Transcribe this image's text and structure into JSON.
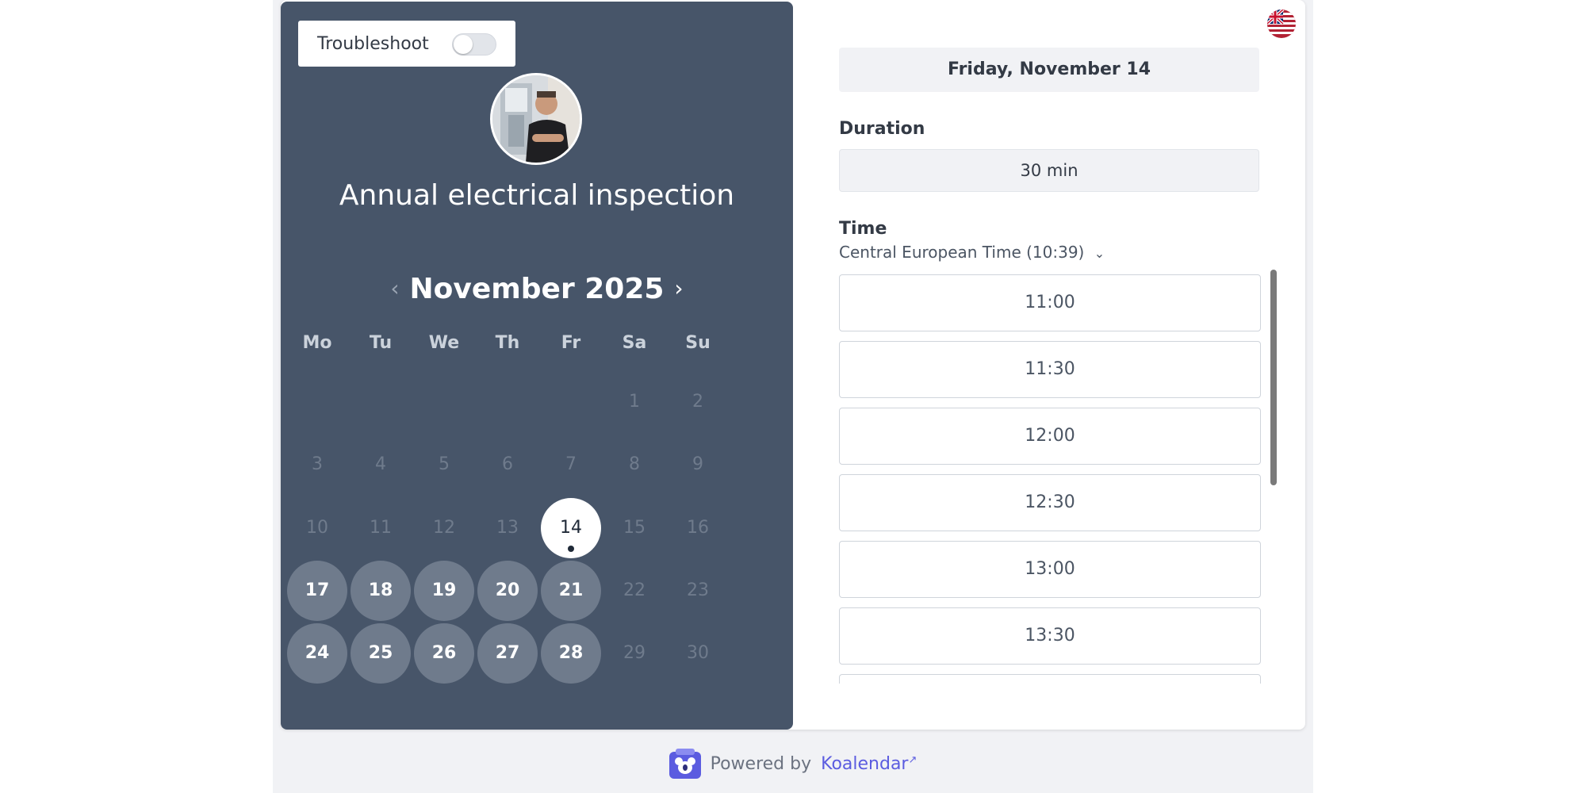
{
  "troubleshoot": {
    "label": "Troubleshoot",
    "enabled": false
  },
  "event": {
    "title": "Annual electrical inspection"
  },
  "calendar": {
    "month_label": "November 2025",
    "prev_icon": "chevron-left-icon",
    "next_icon": "chevron-right-icon",
    "weekdays": [
      "Mo",
      "Tu",
      "We",
      "Th",
      "Fr",
      "Sa",
      "Su"
    ],
    "days": [
      {
        "label": "1",
        "state": "disabled"
      },
      {
        "label": "2",
        "state": "disabled"
      },
      {
        "label": "3",
        "state": "disabled"
      },
      {
        "label": "4",
        "state": "disabled"
      },
      {
        "label": "5",
        "state": "disabled"
      },
      {
        "label": "6",
        "state": "disabled"
      },
      {
        "label": "7",
        "state": "disabled"
      },
      {
        "label": "8",
        "state": "disabled"
      },
      {
        "label": "9",
        "state": "disabled"
      },
      {
        "label": "10",
        "state": "disabled"
      },
      {
        "label": "11",
        "state": "disabled"
      },
      {
        "label": "12",
        "state": "disabled"
      },
      {
        "label": "13",
        "state": "disabled"
      },
      {
        "label": "14",
        "state": "selected"
      },
      {
        "label": "15",
        "state": "disabled"
      },
      {
        "label": "16",
        "state": "disabled"
      },
      {
        "label": "17",
        "state": "available"
      },
      {
        "label": "18",
        "state": "available"
      },
      {
        "label": "19",
        "state": "available"
      },
      {
        "label": "20",
        "state": "available"
      },
      {
        "label": "21",
        "state": "available"
      },
      {
        "label": "22",
        "state": "disabled"
      },
      {
        "label": "23",
        "state": "disabled"
      },
      {
        "label": "24",
        "state": "available"
      },
      {
        "label": "25",
        "state": "available"
      },
      {
        "label": "26",
        "state": "available"
      },
      {
        "label": "27",
        "state": "available"
      },
      {
        "label": "28",
        "state": "available"
      },
      {
        "label": "29",
        "state": "disabled"
      },
      {
        "label": "30",
        "state": "disabled"
      }
    ]
  },
  "booking": {
    "selected_date": "Friday, November 14",
    "duration_label": "Duration",
    "duration_value": "30 min",
    "time_label": "Time",
    "timezone": "Central European Time (10:39)",
    "slots": [
      "11:00",
      "11:30",
      "12:00",
      "12:30",
      "13:00",
      "13:30",
      ""
    ]
  },
  "language": {
    "icon": "uk-flag-icon"
  },
  "footer": {
    "prefix": "Powered by",
    "brand": "Koalendar"
  },
  "colors": {
    "panel": "#475569",
    "accent": "#5b5ce0",
    "available_day": "#6f7b8c"
  }
}
